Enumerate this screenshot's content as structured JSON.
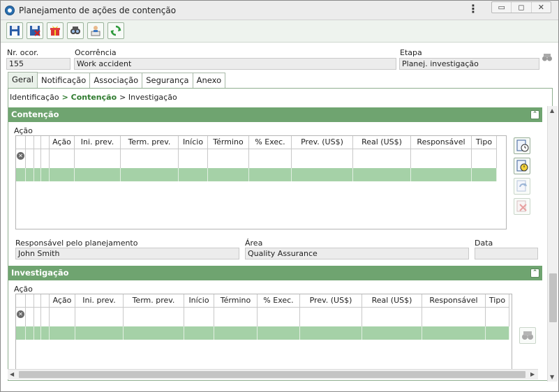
{
  "window": {
    "title": "Planejamento de ações de contenção",
    "menu_label": "⋮",
    "minimize": "▭",
    "maximize": "◻",
    "close": "✕"
  },
  "toolbar": {
    "buttons": [
      {
        "name": "save-icon"
      },
      {
        "name": "save-close-icon"
      },
      {
        "name": "gift-icon"
      },
      {
        "name": "binoculars-user-icon"
      },
      {
        "name": "person-document-icon"
      },
      {
        "name": "refresh-icon"
      }
    ]
  },
  "header": {
    "nr_label": "Nr. ocor.",
    "nr_value": "155",
    "ocorrencia_label": "Ocorrência",
    "ocorrencia_value": "Work accident",
    "etapa_label": "Etapa",
    "etapa_value": "Planej. investigação"
  },
  "tabs": [
    "Geral",
    "Notificação",
    "Associação",
    "Segurança",
    "Anexo"
  ],
  "breadcrumb": {
    "first": "Identificação",
    "active": "> Contenção",
    "last": "> Investigação"
  },
  "contencao": {
    "title": "Contenção",
    "acao_label": "Ação",
    "columns": [
      "Ação",
      "Ini. prev.",
      "Term. prev.",
      "Início",
      "Término",
      "% Exec.",
      "Prev. (US$)",
      "Real (US$)",
      "Responsável",
      "Tipo"
    ],
    "responsavel_label": "Responsável pelo planejamento",
    "responsavel_value": "John Smith",
    "area_label": "Área",
    "area_value": "Quality Assurance",
    "data_label": "Data",
    "data_value": ""
  },
  "investigacao": {
    "title": "Investigação",
    "acao_label": "Ação",
    "columns": [
      "Ação",
      "Ini. prev.",
      "Term. prev.",
      "Início",
      "Término",
      "% Exec.",
      "Prev. (US$)",
      "Real (US$)",
      "Responsável",
      "Tipo"
    ]
  },
  "colors": {
    "section_green": "#6fa470",
    "row_green": "#a5d1a7",
    "active_text": "#2f7b2f"
  }
}
